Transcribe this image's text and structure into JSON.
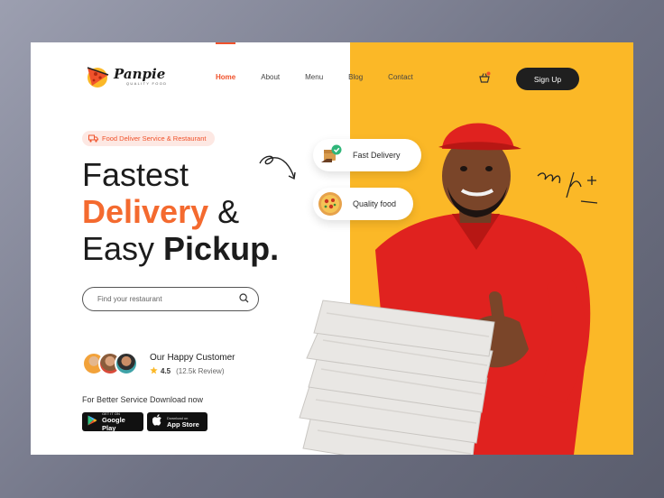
{
  "brand": {
    "name": "Panpie",
    "tagline": "QUALITY FOOD"
  },
  "nav": {
    "items": [
      {
        "label": "Home",
        "active": true
      },
      {
        "label": "About",
        "active": false
      },
      {
        "label": "Menu",
        "active": false
      },
      {
        "label": "Blog",
        "active": false
      },
      {
        "label": "Contact",
        "active": false
      }
    ],
    "signup_label": "Sign Up",
    "cart_icon": "basket-icon"
  },
  "hero": {
    "badge": "Food Deliver Service & Restaurant",
    "headline": {
      "line1": "Fastest",
      "line2_highlight": "Delivery",
      "line2_rest": " &",
      "line3_regular": "Easy ",
      "line3_bold": "Pickup."
    },
    "search": {
      "placeholder": "Find your restaurant",
      "value": ""
    }
  },
  "customers": {
    "title": "Our Happy Customer",
    "rating": "4.5",
    "reviews": "(12.5k Review)"
  },
  "download": {
    "text": "For Better Service Download now",
    "google_play": {
      "small": "GET IT ON",
      "big": "Google Play"
    },
    "app_store": {
      "small": "Download on",
      "big": "App Store"
    }
  },
  "pills": {
    "fast_delivery": "Fast Delivery",
    "quality_food": "Quality food"
  },
  "colors": {
    "accent": "#f0522b",
    "headline_orange": "#f46a2f",
    "yellow": "#fbb827",
    "dark": "#1f1f1f"
  }
}
